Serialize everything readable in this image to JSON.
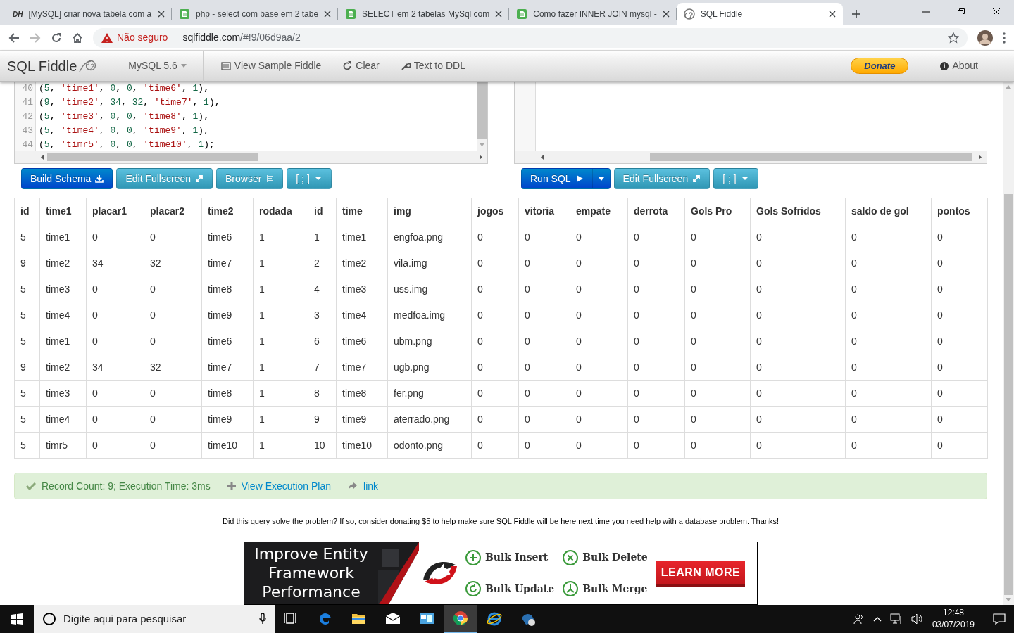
{
  "browser": {
    "tabs": [
      {
        "title": "[MySQL] criar nova tabela com a",
        "kind": "letters",
        "logo_text": "DH",
        "selected": false
      },
      {
        "title": "php - select com base em 2 tabe",
        "kind": "page",
        "selected": false
      },
      {
        "title": "SELECT em 2 tabelas MySql com",
        "kind": "page",
        "selected": false
      },
      {
        "title": "Como fazer INNER JOIN mysql -",
        "kind": "page",
        "selected": false
      },
      {
        "title": "SQL Fiddle",
        "kind": "fiddle",
        "selected": true
      }
    ],
    "security": "Não seguro",
    "url_host": "sqlfiddle.com",
    "url_path": "/#!9/06d9aa/2"
  },
  "navbar": {
    "brand": "SQL Fiddle",
    "database": "MySQL 5.6",
    "items": [
      {
        "label": "View Sample Fiddle",
        "kind": "list"
      },
      {
        "label": "Clear",
        "kind": "refresh"
      },
      {
        "label": "Text to DDL",
        "kind": "wrench"
      }
    ],
    "donate": "Donate",
    "about": "About"
  },
  "schema_panel": {
    "lines": [
      {
        "number": "40",
        "code": "(5, 'time1', 0, 0, 'time6', 1),"
      },
      {
        "number": "41",
        "code": "(9, 'time2', 34, 32, 'time7', 1),"
      },
      {
        "number": "42",
        "code": "(5, 'time3', 0, 0, 'time8', 1),"
      },
      {
        "number": "43",
        "code": "(5, 'time4', 0, 0, 'time9', 1),"
      },
      {
        "number": "44",
        "code": "(5, 'timr5', 0, 0, 'time10', 1);"
      }
    ],
    "buttons": [
      {
        "label": "Build Schema",
        "kind": "build"
      },
      {
        "label": "Edit Fullscreen",
        "kind": "fullscreen"
      },
      {
        "label": "Browser",
        "kind": "browser"
      },
      {
        "label": "[ ; ]",
        "kind": "format"
      }
    ]
  },
  "query_panel": {
    "buttons": [
      {
        "label": "Run SQL",
        "kind": "run"
      },
      {
        "label": "Edit Fullscreen",
        "kind": "fullscreen"
      },
      {
        "label": "[ ; ]",
        "kind": "format"
      }
    ]
  },
  "table": {
    "columns": [
      "id",
      "time1",
      "placar1",
      "placar2",
      "time2",
      "rodada",
      "id",
      "time",
      "img",
      "jogos",
      "vitoria",
      "empate",
      "derrota",
      "Gols Pro",
      "Gols Sofridos",
      "saldo de gol",
      "pontos"
    ],
    "rows": [
      [
        "5",
        "time1",
        "0",
        "0",
        "time6",
        "1",
        "1",
        "time1",
        "engfoa.png",
        "0",
        "0",
        "0",
        "0",
        "0",
        "0",
        "0",
        "0"
      ],
      [
        "9",
        "time2",
        "34",
        "32",
        "time7",
        "1",
        "2",
        "time2",
        "vila.img",
        "0",
        "0",
        "0",
        "0",
        "0",
        "0",
        "0",
        "0"
      ],
      [
        "5",
        "time3",
        "0",
        "0",
        "time8",
        "1",
        "4",
        "time3",
        "uss.img",
        "0",
        "0",
        "0",
        "0",
        "0",
        "0",
        "0",
        "0"
      ],
      [
        "5",
        "time4",
        "0",
        "0",
        "time9",
        "1",
        "3",
        "time4",
        "medfoa.img",
        "0",
        "0",
        "0",
        "0",
        "0",
        "0",
        "0",
        "0"
      ],
      [
        "5",
        "time1",
        "0",
        "0",
        "time6",
        "1",
        "6",
        "time6",
        "ubm.png",
        "0",
        "0",
        "0",
        "0",
        "0",
        "0",
        "0",
        "0"
      ],
      [
        "9",
        "time2",
        "34",
        "32",
        "time7",
        "1",
        "7",
        "time7",
        "ugb.png",
        "0",
        "0",
        "0",
        "0",
        "0",
        "0",
        "0",
        "0"
      ],
      [
        "5",
        "time3",
        "0",
        "0",
        "time8",
        "1",
        "8",
        "time8",
        "fer.png",
        "0",
        "0",
        "0",
        "0",
        "0",
        "0",
        "0",
        "0"
      ],
      [
        "5",
        "time4",
        "0",
        "0",
        "time9",
        "1",
        "9",
        "time9",
        "aterrado.png",
        "0",
        "0",
        "0",
        "0",
        "0",
        "0",
        "0",
        "0"
      ],
      [
        "5",
        "timr5",
        "0",
        "0",
        "time10",
        "1",
        "10",
        "time10",
        "odonto.png",
        "0",
        "0",
        "0",
        "0",
        "0",
        "0",
        "0",
        "0"
      ]
    ]
  },
  "result": {
    "status": "Record Count: 9; Execution Time: 3ms",
    "plan_link": "View Execution Plan",
    "link": "link"
  },
  "donate_message": "Did this query solve the problem? If so, consider donating $5 to help make sure SQL Fiddle will be here next time you need help with a database problem. Thanks!",
  "ad": {
    "headline": "Improve Entity Framework Performance",
    "features": [
      {
        "label": "Bulk Insert",
        "kind": "insert"
      },
      {
        "label": "Bulk Delete",
        "kind": "delete"
      },
      {
        "label": "Bulk Update",
        "kind": "update"
      },
      {
        "label": "Bulk Merge",
        "kind": "merge"
      }
    ],
    "cta": "LEARN MORE"
  },
  "taskbar": {
    "search_placeholder": "Digite aqui para pesquisar",
    "apps": [
      {
        "kind": "taskview",
        "selected": false
      },
      {
        "kind": "edge",
        "selected": false
      },
      {
        "kind": "folder",
        "selected": false
      },
      {
        "kind": "mail",
        "selected": false
      },
      {
        "kind": "store",
        "selected": false
      },
      {
        "kind": "chrome",
        "selected": true
      },
      {
        "kind": "ie",
        "selected": false
      },
      {
        "kind": "globe",
        "selected": false
      }
    ],
    "time": "12:48",
    "date": "03/07/2019"
  }
}
